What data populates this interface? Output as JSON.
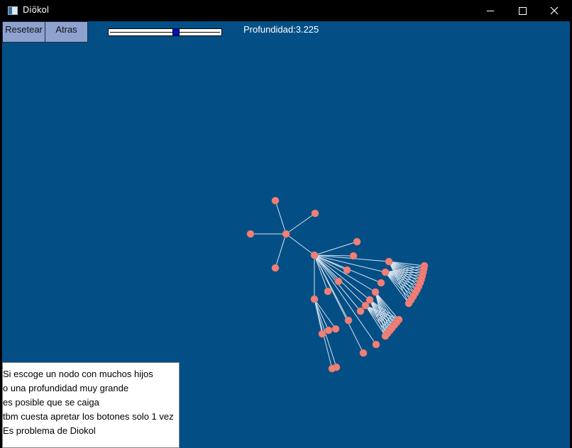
{
  "window": {
    "title": "Diökol",
    "icon": "app-window-icon",
    "controls": [
      "minimize-icon",
      "maximize-icon",
      "close-icon"
    ]
  },
  "toolbar": {
    "reset_label": "Resetear",
    "back_label": "Atras"
  },
  "depth_slider": {
    "value_fraction": 0.59
  },
  "depth_readout": "Profundidad:3.225",
  "note": {
    "lines": [
      "Si escoge un nodo con muchos hijos",
      "o una profundidad muy grande",
      "es posible que se caiga",
      "tbm cuesta apretar los botones solo 1 vez",
      "Es problema de Diokol"
    ]
  },
  "colors": {
    "canvas": "#034f85",
    "node": "#f08078",
    "edge": "#d8e2ee",
    "button": "#8ea2cf",
    "slider_thumb": "#0012c8"
  }
}
